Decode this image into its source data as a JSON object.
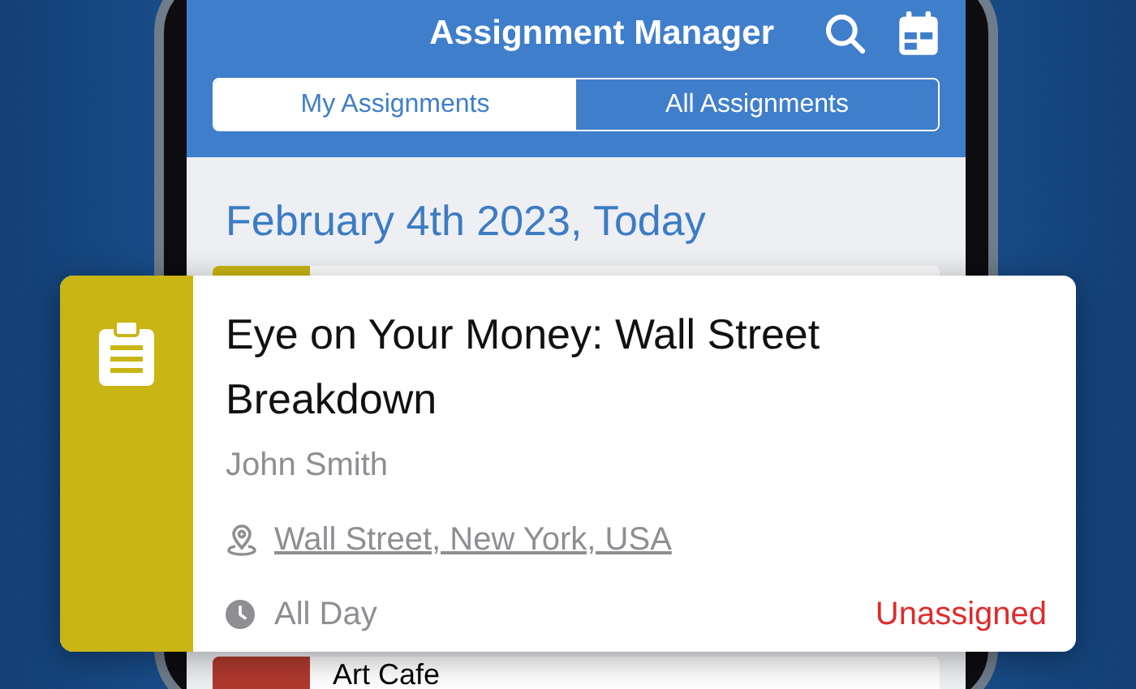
{
  "header": {
    "title": "Assignment Manager"
  },
  "tabs": [
    {
      "label": "My Assignments",
      "selected": true
    },
    {
      "label": "All Assignments",
      "selected": false
    }
  ],
  "date_heading": "February 4th 2023, Today",
  "list": [
    {
      "color": "#c9b514"
    },
    {
      "title": "Art Cafe",
      "color": "#b03a2e"
    }
  ],
  "featured": {
    "title": "Eye on Your Money: Wall Street Breakdown",
    "person": "John Smith",
    "location": "Wall Street, New York, USA",
    "time": "All Day",
    "status": "Unassigned",
    "color": "#c9b514"
  }
}
